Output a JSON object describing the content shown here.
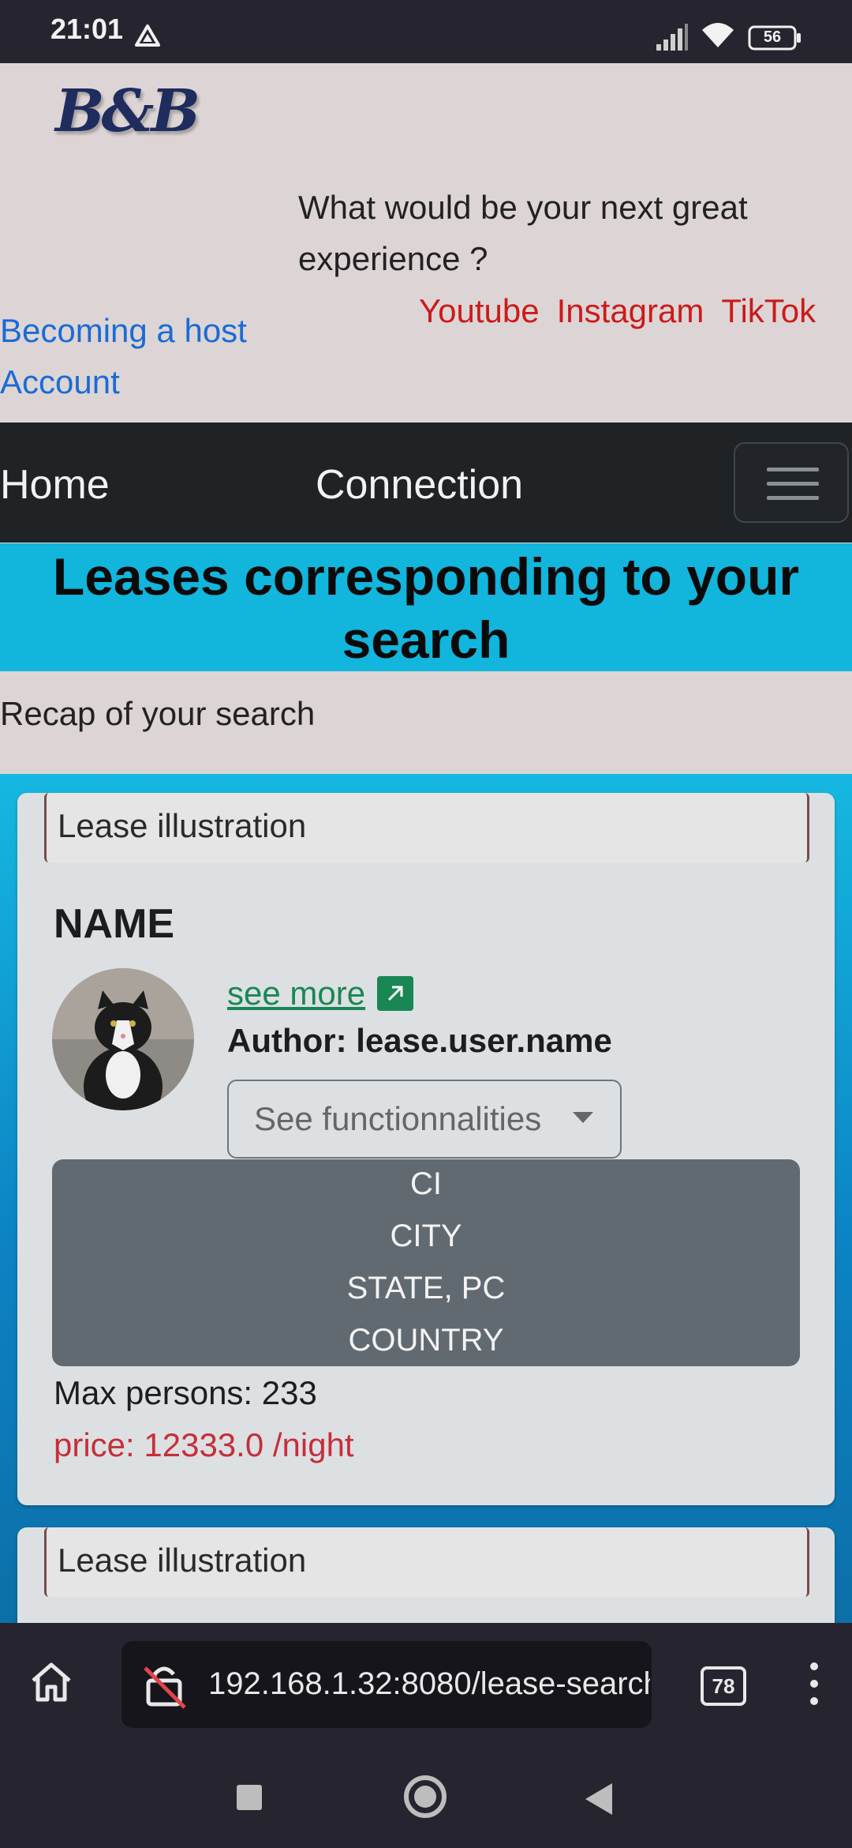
{
  "status_bar": {
    "time": "21:01",
    "battery": "56"
  },
  "header": {
    "logo": "B&B",
    "tagline": "What would be your next great experience ?",
    "social": [
      "Youtube",
      "Instagram",
      "TikTok"
    ],
    "links": [
      "Becoming a host",
      "Account"
    ]
  },
  "navbar": {
    "home": "Home",
    "connection": "Connection"
  },
  "page_title": "Leases corresponding to your search",
  "recap": "Recap of your search",
  "card": {
    "illustration_alt": "Lease illustration",
    "name": "NAME",
    "see_more": "see more",
    "author": "Author: lease.user.name",
    "functionalities_button": "See functionnalities",
    "address": [
      "CI",
      "CITY",
      "STATE, PC",
      "COUNTRY"
    ],
    "max_persons": "Max persons: 233",
    "price": "price: 12333.0 /night"
  },
  "card2": {
    "illustration_alt": "Lease illustration"
  },
  "browser": {
    "url": "192.168.1.32:8080/lease-search",
    "tabs_count": "78"
  },
  "icons": {
    "status": [
      "drive-icon",
      "signal-icon",
      "wifi-icon",
      "battery-icon"
    ],
    "browser": [
      "home-icon",
      "insecure-lock-icon",
      "tabs-icon",
      "menu-dots-icon"
    ],
    "system": [
      "recent-apps-icon",
      "home-button-icon",
      "back-icon"
    ]
  },
  "colors": {
    "accent_cyan": "#12b5dc",
    "navbar": "#1f2326",
    "link_blue": "#1a6bd6",
    "social_red": "#cc1a1a",
    "price_red": "#c62e3a",
    "see_more_green": "#198754"
  }
}
